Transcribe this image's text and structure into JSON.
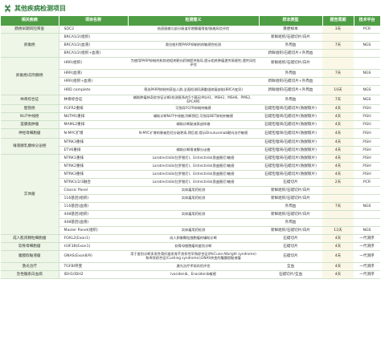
{
  "title": "其他疾病检测项目",
  "headers": [
    "相关疾病",
    "项目名称",
    "检测意义",
    "样本类型",
    "报告周期",
    "技术平台"
  ],
  "colors": {
    "header": "#4f9e45",
    "title": "#2e7d3a",
    "category_bg": "#eef6e7",
    "tat_bg": "#fbf7e6"
  },
  "icon": "logo-icon",
  "groups": [
    {
      "disease": "肠癌早期风险筛查",
      "rows": [
        {
          "project": "SDC2",
          "significance": "结直肠癌与部分肠道早期腺瘤筛查/肠癌风险评估",
          "sample": "粪便样本",
          "tat": "3天",
          "platform": "PCR"
        }
      ]
    },
    {
      "disease": "卵巢癌",
      "rows": [
        {
          "project": "BRCA1/2(组织)",
          "significance": "",
          "sample": "新鲜组织/石蜡切片/白片",
          "tat": "",
          "platform": ""
        },
        {
          "project": "BRCA1/2(血液)",
          "significance": "奥拉帕利等PARP抑制剂的敏感性检测",
          "sample": "外周血",
          "tat": "7天",
          "platform": "NGS"
        },
        {
          "project": "BRCA1/2(组织+血液)",
          "significance": "",
          "sample": "新鲜组织/石蜡切片+外周血",
          "tat": "",
          "platform": ""
        }
      ]
    },
    {
      "disease": "卵巢癌/前列腺癌",
      "rows": [
        {
          "project": "HRR(组织)",
          "significance": "为使用PARP抑制剂和其他相关靶向药物提供指导,提示相关肿瘤遗传易感性;遗传风险评估",
          "sample": "新鲜组织/石蜡切片/白片",
          "tat": "",
          "platform": ""
        },
        {
          "project": "HRR(血液)",
          "significance": "",
          "sample": "外周血",
          "tat": "7天",
          "platform": "NGS"
        },
        {
          "project": "HRR(组织+血液)",
          "significance": "",
          "sample": "新鲜组织/石蜡切片+外周血",
          "tat": "",
          "platform": ""
        },
        {
          "project": "HRD complete",
          "significance": "筛选PARP抑制剂获益人群,全面检测同源重组修复缺陷(BRCA变异)",
          "sample": "新鲜组织/石蜡切片+外周血",
          "tat": "10天",
          "platform": "NGS"
        }
      ]
    },
    {
      "disease": "林奇综合征",
      "rows": [
        {
          "project": "林奇综合征",
          "significance": "辅助肿瘤林奇综合征诊断(检测胚系的5个基因:MLH1、MSH2、MSH6、PMS2、EPCAM)",
          "sample": "外周血",
          "tat": "7天",
          "platform": "NGS"
        }
      ]
    },
    {
      "disease": "胆管癌",
      "rows": [
        {
          "project": "FGFR2重排",
          "significance": "可指导FGFR抑制剂敏感",
          "sample": "石蜡包埋块/石蜡切片(防脱玻片)",
          "tat": "4天",
          "platform": "FISH"
        }
      ]
    },
    {
      "disease": "NUT中线癌",
      "rows": [
        {
          "project": "NUTM1重排",
          "significance": "辅助诊断NUT中线癌;判断预后;可指导BET抑制剂敏感",
          "sample": "石蜡包埋块/石蜡切片(防脱玻片)",
          "tat": "4天",
          "platform": "FISH"
        }
      ]
    },
    {
      "disease": "涎腺类肿瘤",
      "rows": [
        {
          "project": "MAML2重排",
          "significance": "辅助诊断黏液表皮样癌",
          "sample": "石蜡包埋块/石蜡切片(防脱玻片)",
          "tat": "4天",
          "platform": "FISH"
        }
      ]
    },
    {
      "disease": "神经母细胞瘤",
      "rows": [
        {
          "project": "N-MYC扩增",
          "significance": "N-MYC扩增的患者危险分级更高,预后差;提示Dinutuximab靶向治疗敏感",
          "sample": "石蜡包埋块/石蜡切片(防脱玻片)",
          "tat": "4天",
          "platform": "FISH"
        }
      ]
    },
    {
      "disease": "唾液腺乳腺样分泌癌",
      "rows": [
        {
          "project": "NTRK3重排",
          "significance": "",
          "sample": "石蜡包埋块/石蜡切片(防脱玻片)",
          "tat": "4天",
          "platform": "FISH"
        },
        {
          "project": "ETV6重排",
          "significance": "辅助诊断唾液腺分泌癌",
          "sample": "石蜡包埋块/石蜡切片(防脱玻片)",
          "tat": "4天",
          "platform": "FISH"
        }
      ]
    },
    {
      "disease": "实体瘤",
      "rows": [
        {
          "project": "NTRK1重排",
          "significance": "Larotrectinib(拉罗替尼)、Entrectinib(恩曲替尼)敏感",
          "sample": "石蜡包埋块/石蜡切片(防脱玻片)",
          "tat": "4天",
          "platform": "FISH"
        },
        {
          "project": "NTRK2重排",
          "significance": "Larotrectinib(拉罗替尼)、Entrectinib(恩曲替尼)敏感",
          "sample": "石蜡包埋块/石蜡切片(防脱玻片)",
          "tat": "4天",
          "platform": "FISH"
        },
        {
          "project": "NTRK3重排",
          "significance": "Larotrectinib(拉罗替尼)、Entrectinib(恩曲替尼)敏感",
          "sample": "石蜡包埋块/石蜡切片(防脱玻片)",
          "tat": "4天",
          "platform": "FISH"
        },
        {
          "project": "NTRK1/2/3融合",
          "significance": "Larotrectinib(拉罗替尼)、Entrectinib(恩曲替尼)敏感",
          "sample": "石蜡切片",
          "tat": "2天",
          "platform": "PCR"
        },
        {
          "project": "Classic Panel",
          "significance": "实体瘤用药检测",
          "sample": "新鲜组织/石蜡切片/白片",
          "tat": "",
          "platform": ""
        },
        {
          "project": "116基因(组织)",
          "significance": "实体瘤用药检测",
          "sample": "新鲜组织/石蜡切片/白片",
          "tat": "",
          "platform": ""
        },
        {
          "project": "116基因(血液)",
          "significance": "",
          "sample": "外周血",
          "tat": "7天",
          "platform": "NGS"
        },
        {
          "project": "448基因(组织)",
          "significance": "实体瘤用药检测",
          "sample": "新鲜组织/石蜡切片/白片",
          "tat": "",
          "platform": ""
        },
        {
          "project": "448基因(血液)",
          "significance": "",
          "sample": "外周血",
          "tat": "",
          "platform": ""
        },
        {
          "project": "Master Panel(组织)",
          "significance": "实体瘤用药检测",
          "sample": "新鲜组织/石蜡切片/白片",
          "tat": "12天",
          "platform": "NGS"
        }
      ]
    },
    {
      "disease": "成人肌肉颗粒细胞瘤",
      "rows": [
        {
          "project": "FOXL2(Exon1)",
          "significance": "成人卵巢颗粒细胞瘤的辅助诊断",
          "sample": "石蜡切片",
          "tat": "4天",
          "platform": "一代测序"
        }
      ]
    },
    {
      "disease": "软骨母细胞瘤",
      "rows": [
        {
          "project": "H3F3B(Exon1)",
          "significance": "软骨母细胞瘤的鉴别诊断",
          "sample": "石蜡切片",
          "tat": "4天",
          "platform": "一代测序"
        }
      ]
    },
    {
      "disease": "腹膜假黏液瘤",
      "rows": [
        {
          "project": "GNAS(Exon8/9)",
          "significance": "用于鉴别诊断多发性骨纤维发育不良伴性早熟综合征(McCune-Albright syndrome)和库欣综合征(Cushing syndrome);GNAS突变的腹膜假黏液瘤",
          "sample": "石蜡切片",
          "tat": "4天",
          "platform": "一代测序"
        }
      ]
    },
    {
      "disease": "激光治疗",
      "rows": [
        {
          "project": "TGFBI突变",
          "significance": "激光治疗术前风险评估",
          "sample": "全血",
          "tat": "4天",
          "platform": "一代测序"
        }
      ]
    },
    {
      "disease": "急性髓系白血病",
      "rows": [
        {
          "project": "IDH1/IDH2",
          "significance": "Ivosidenib、Enasidenib敏感",
          "sample": "石蜡切片/全血",
          "tat": "4天",
          "platform": "一代测序"
        }
      ]
    }
  ]
}
